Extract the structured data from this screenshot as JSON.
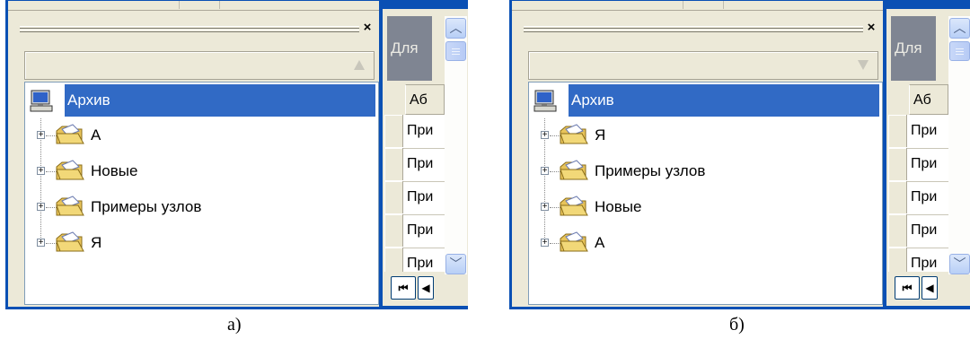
{
  "panels": [
    {
      "id": "a",
      "caption": "а)",
      "sort_direction": "ascending",
      "tree": {
        "root_label": "Архив",
        "nodes": [
          "А",
          "Новые",
          "Примеры узлов",
          "Я"
        ]
      },
      "list": {
        "header_label": "Для",
        "column_header": "Аб",
        "rows": [
          "При",
          "При",
          "При",
          "При",
          "При"
        ]
      }
    },
    {
      "id": "b",
      "caption": "б)",
      "sort_direction": "descending",
      "tree": {
        "root_label": "Архив",
        "nodes": [
          "Я",
          "Примеры узлов",
          "Новые",
          "А"
        ]
      },
      "list": {
        "header_label": "Для",
        "column_header": "Аб",
        "rows": [
          "При",
          "При",
          "При",
          "При",
          "При"
        ]
      }
    }
  ],
  "icons": {
    "close": "close-icon",
    "computer": "computer-icon",
    "folder": "folder-icon",
    "expand": "plus-expander-icon",
    "scroll_up": "chevron-up-icon",
    "scroll_down": "chevron-down-icon",
    "nav_first": "first-record-icon",
    "nav_prev": "prev-record-icon"
  },
  "colors": {
    "frame": "#0a50b4",
    "selection": "#316ac5",
    "pane_bg": "#ece9d8"
  },
  "glyphs": {
    "close": "×",
    "expand": "+",
    "scroll_up": "︿",
    "scroll_down": "﹀",
    "nav_first": "⏮",
    "nav_prev": "◀"
  }
}
